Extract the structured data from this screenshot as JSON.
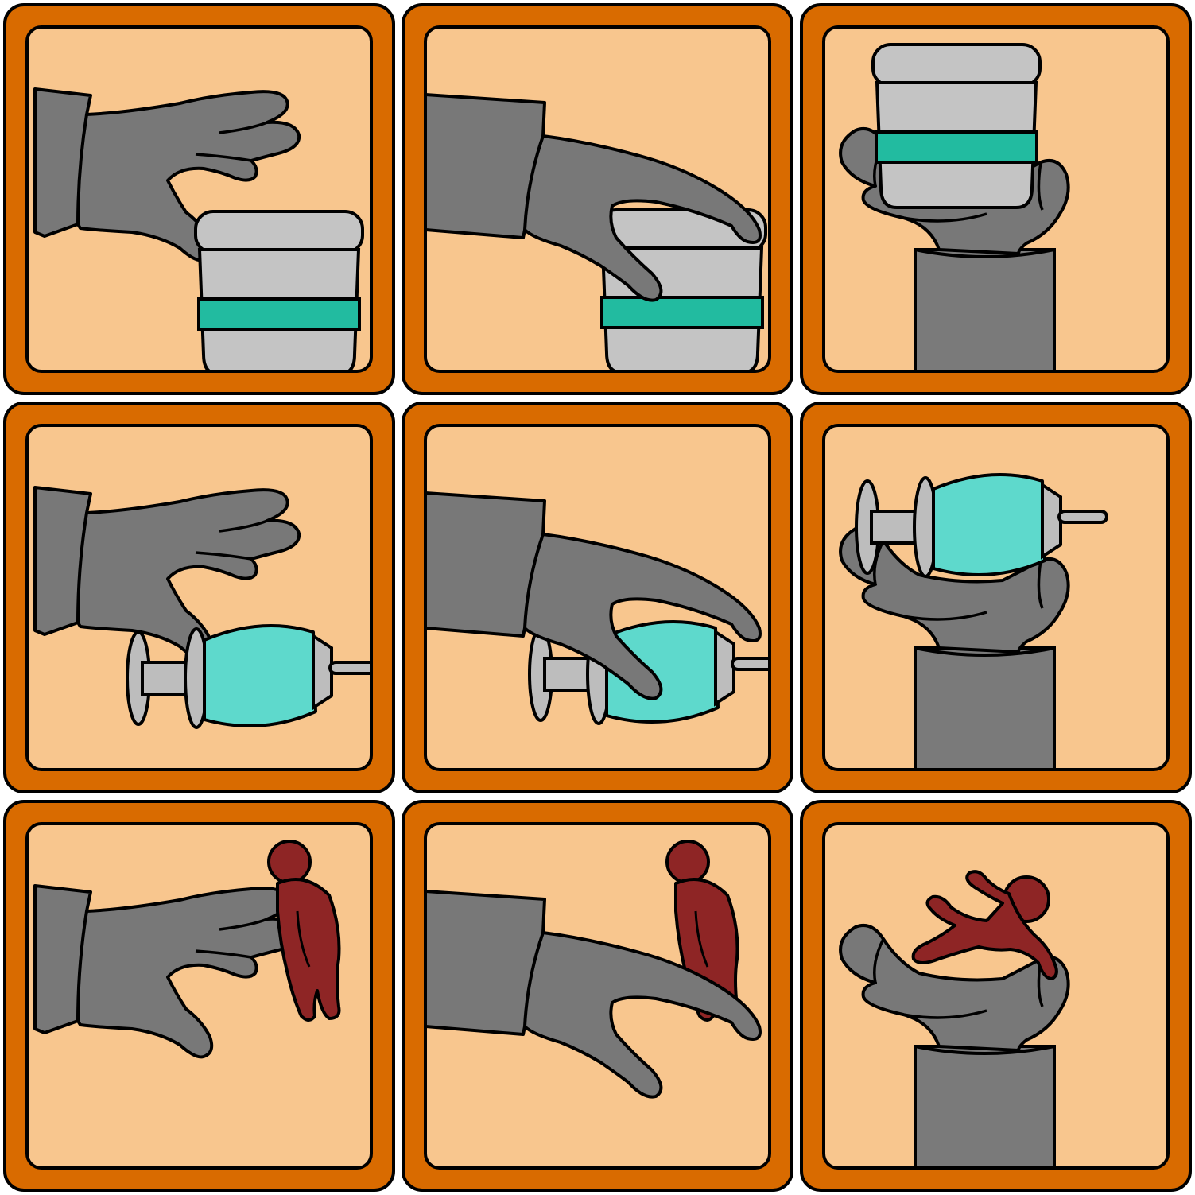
{
  "colors": {
    "frame": "#D96B00",
    "panel": "#F8C68E",
    "outline": "#000000",
    "hand": "#787878",
    "sleeve": "#7A7A7A",
    "jar": "#C4C4C4",
    "jar_band": "#22BBA0",
    "syringe_body": "#5ED9CC",
    "syringe_metal": "#BDBDBD",
    "figure": "#8E2525"
  },
  "panels": [
    {
      "id": "r1c1",
      "scene": "reach",
      "object": "jar"
    },
    {
      "id": "r1c2",
      "scene": "grasp",
      "object": "jar"
    },
    {
      "id": "r1c3",
      "scene": "lift",
      "object": "jar"
    },
    {
      "id": "r2c1",
      "scene": "reach",
      "object": "syringe"
    },
    {
      "id": "r2c2",
      "scene": "grasp",
      "object": "syringe"
    },
    {
      "id": "r2c3",
      "scene": "lift",
      "object": "syringe"
    },
    {
      "id": "r3c1",
      "scene": "reach",
      "object": "figure"
    },
    {
      "id": "r3c2",
      "scene": "grasp",
      "object": "figure"
    },
    {
      "id": "r3c3",
      "scene": "lift",
      "object": "figure"
    }
  ]
}
